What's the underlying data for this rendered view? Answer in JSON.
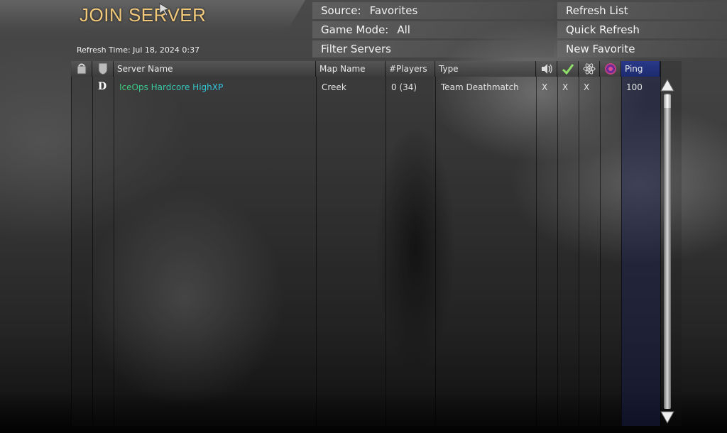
{
  "header": {
    "title": "JOIN SERVER",
    "refresh_time": "Refresh Time: Jul 18, 2024  0:37"
  },
  "filters": {
    "source_label": "Source:",
    "source_value": "Favorites",
    "game_mode_label": "Game Mode:",
    "game_mode_value": "All",
    "filter_servers_label": "Filter Servers"
  },
  "actions": {
    "refresh_list": "Refresh List",
    "quick_refresh": "Quick Refresh",
    "new_favorite": "New Favorite"
  },
  "columns": {
    "server_name": "Server Name",
    "map_name": "Map Name",
    "players": "#Players",
    "type": "Type",
    "ping": "Ping"
  },
  "rows": [
    {
      "status_icon": "D",
      "server_name": "IceOps Hardcore HighXP",
      "map_name": "Creek",
      "players": "0 (34)",
      "type": "Team Deathmatch",
      "voice": "X",
      "pure": "X",
      "mod": "X",
      "punkbuster": "",
      "ping": "100"
    }
  ],
  "icons": {
    "lock_column": "lock-icon",
    "shield_column": "shield-icon",
    "voice_column": "speaker-icon",
    "pure_column": "checkmark-icon",
    "mod_column": "atom-icon",
    "punkbuster_column": "punkbuster-icon"
  },
  "colors": {
    "title": "#f2c97a",
    "server_name_start": "#3fd07a",
    "server_name_end": "#2fc8e8",
    "ping_header": "#2a3a8a"
  }
}
